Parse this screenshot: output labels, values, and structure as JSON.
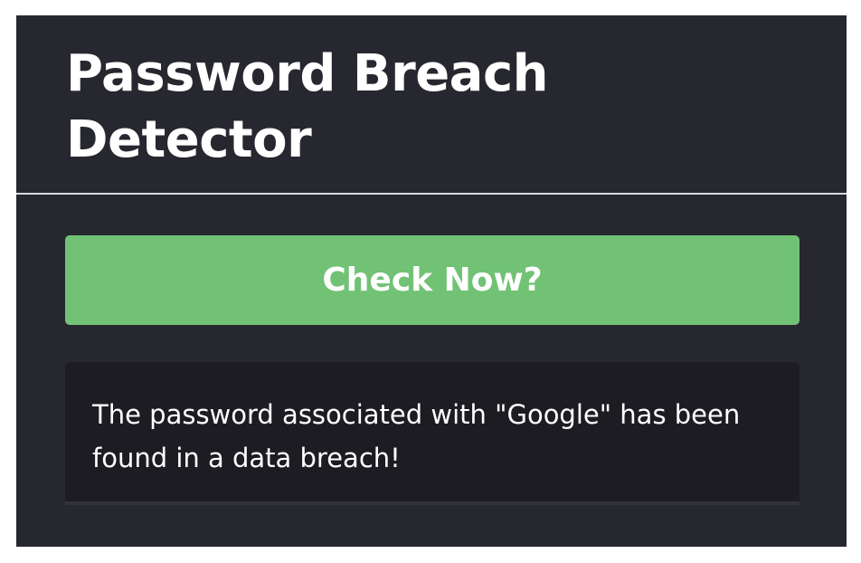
{
  "header": {
    "title": "Password Breach Detector"
  },
  "actions": {
    "check_label": "Check Now?"
  },
  "result": {
    "message": "The password associated with \"Google\" has been found in a data breach!"
  },
  "colors": {
    "panel_background": "#272730",
    "button_background": "#72c275",
    "result_background": "#1c1c22",
    "text": "#ffffff"
  }
}
